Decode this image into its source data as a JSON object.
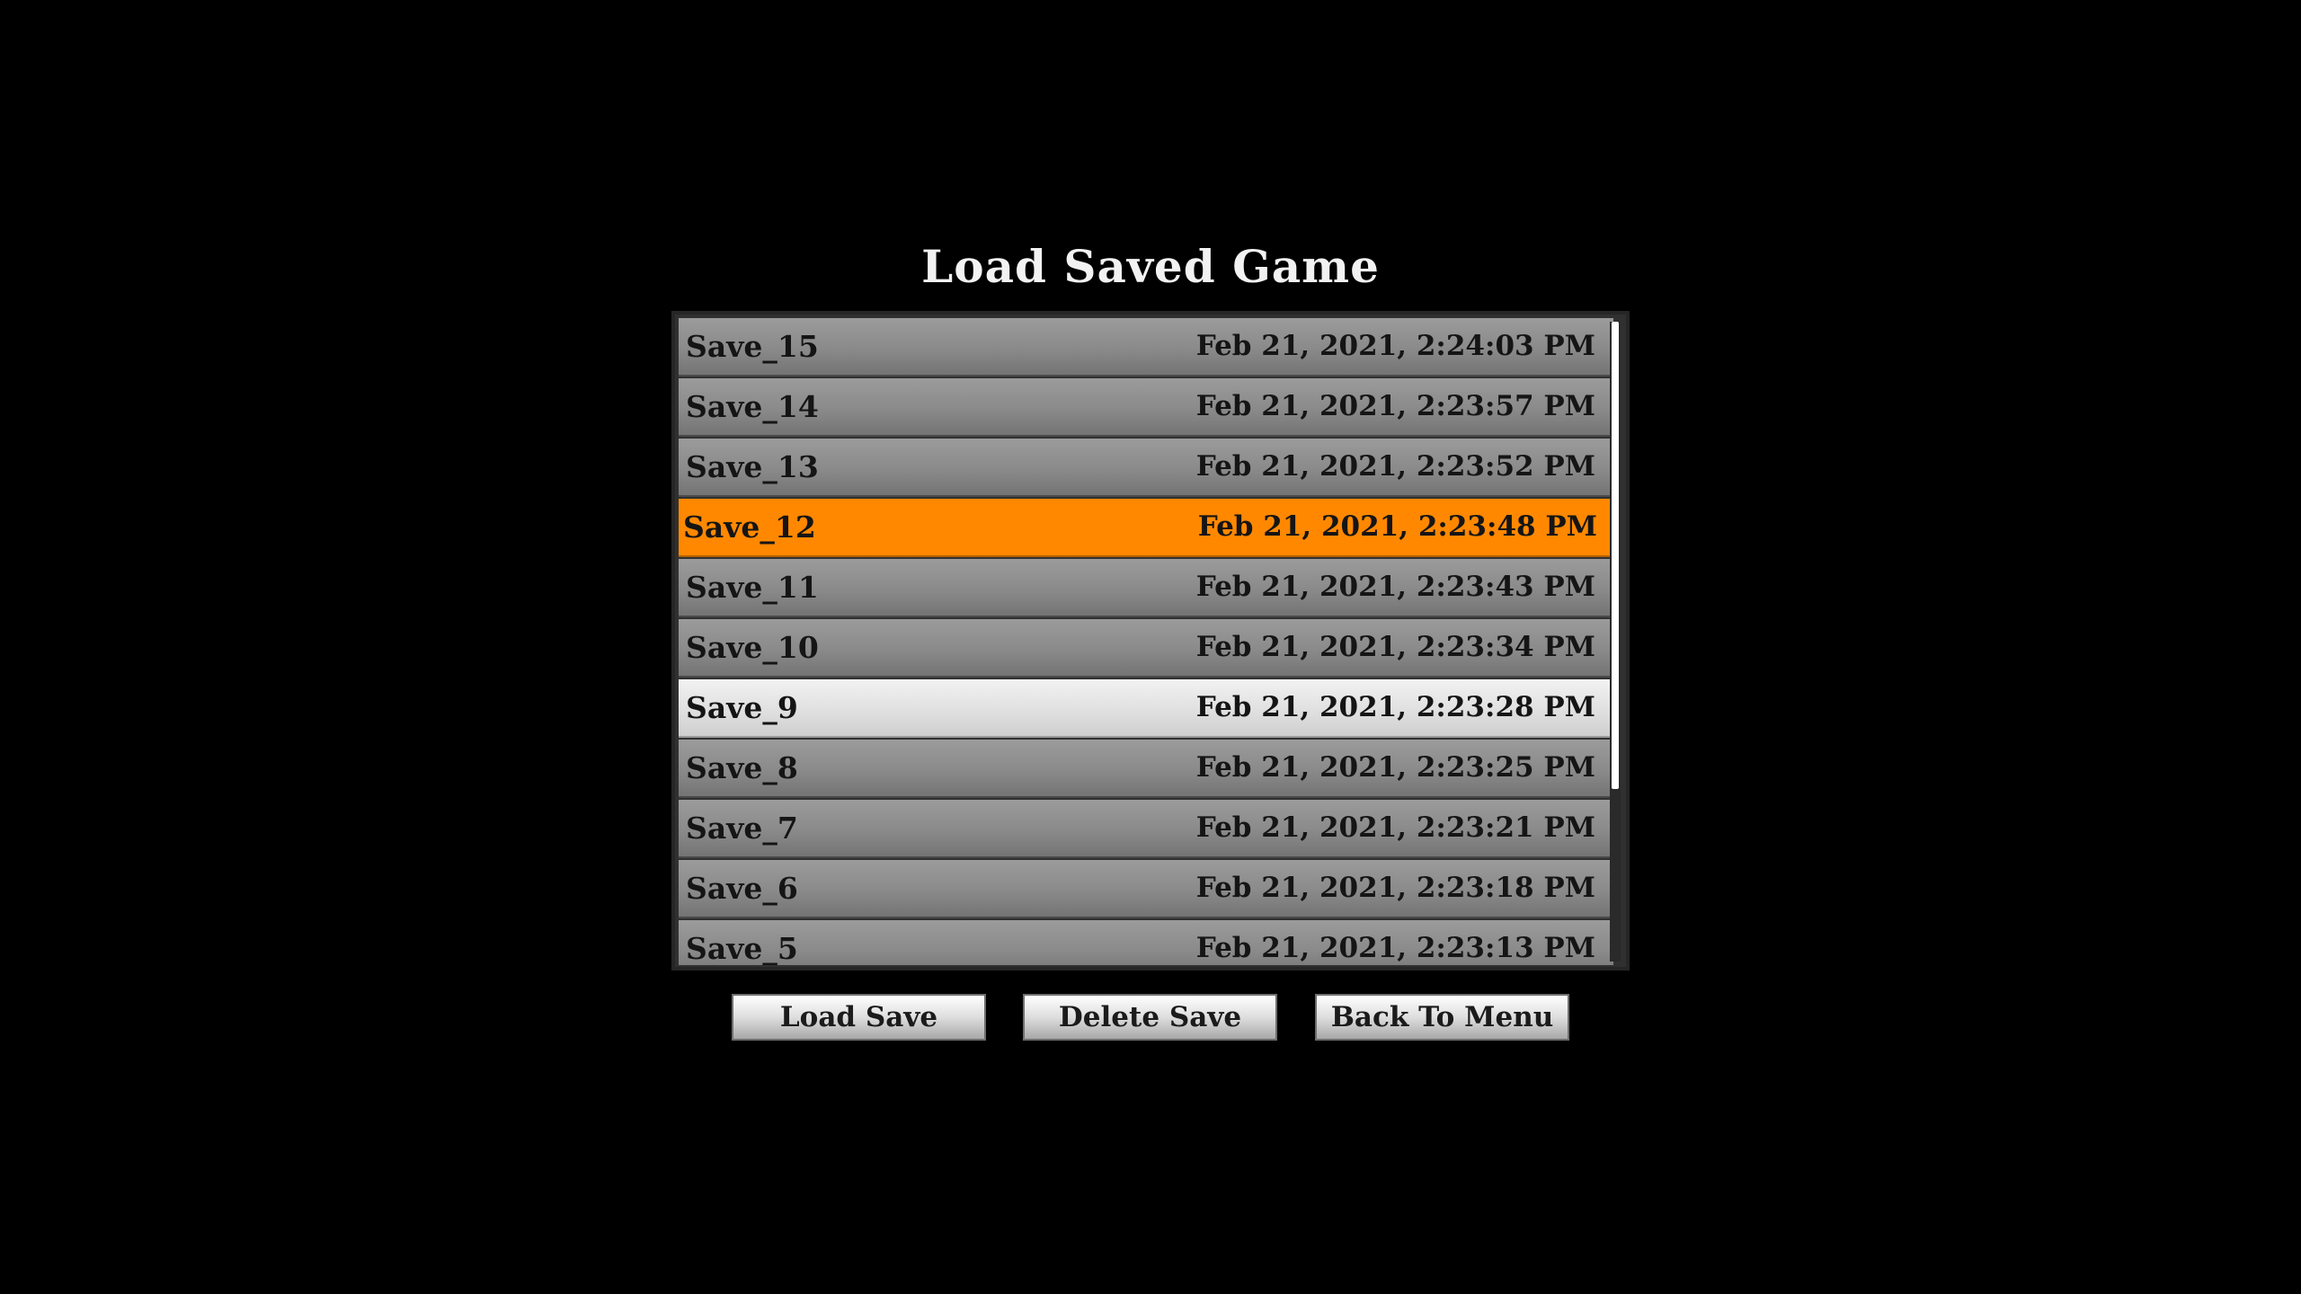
{
  "screen": {
    "title": "Load Saved Game"
  },
  "saves": [
    {
      "name": "Save_15",
      "date": "Feb 21, 2021, 2:24:03 PM",
      "state": "normal"
    },
    {
      "name": "Save_14",
      "date": "Feb 21, 2021, 2:23:57 PM",
      "state": "normal"
    },
    {
      "name": "Save_13",
      "date": "Feb 21, 2021, 2:23:52 PM",
      "state": "normal"
    },
    {
      "name": "Save_12",
      "date": "Feb 21, 2021, 2:23:48 PM",
      "state": "selected"
    },
    {
      "name": "Save_11",
      "date": "Feb 21, 2021, 2:23:43 PM",
      "state": "normal"
    },
    {
      "name": "Save_10",
      "date": "Feb 21, 2021, 2:23:34 PM",
      "state": "normal"
    },
    {
      "name": "Save_9",
      "date": "Feb 21, 2021, 2:23:28 PM",
      "state": "hovered"
    },
    {
      "name": "Save_8",
      "date": "Feb 21, 2021, 2:23:25 PM",
      "state": "normal"
    },
    {
      "name": "Save_7",
      "date": "Feb 21, 2021, 2:23:21 PM",
      "state": "normal"
    },
    {
      "name": "Save_6",
      "date": "Feb 21, 2021, 2:23:18 PM",
      "state": "normal"
    },
    {
      "name": "Save_5",
      "date": "Feb 21, 2021, 2:23:13 PM",
      "state": "normal"
    }
  ],
  "scrollbar": {
    "visible_fraction": 0.73,
    "scroll_position": 0
  },
  "buttons": {
    "load_label": "Load Save",
    "delete_label": "Delete Save",
    "back_label": "Back To Menu"
  },
  "colors": {
    "background": "#000000",
    "selected_row": "#ff8800",
    "hovered_row": "#e6e6e6",
    "normal_row": "#8a8a8a",
    "title_text": "#f2f2f2"
  }
}
